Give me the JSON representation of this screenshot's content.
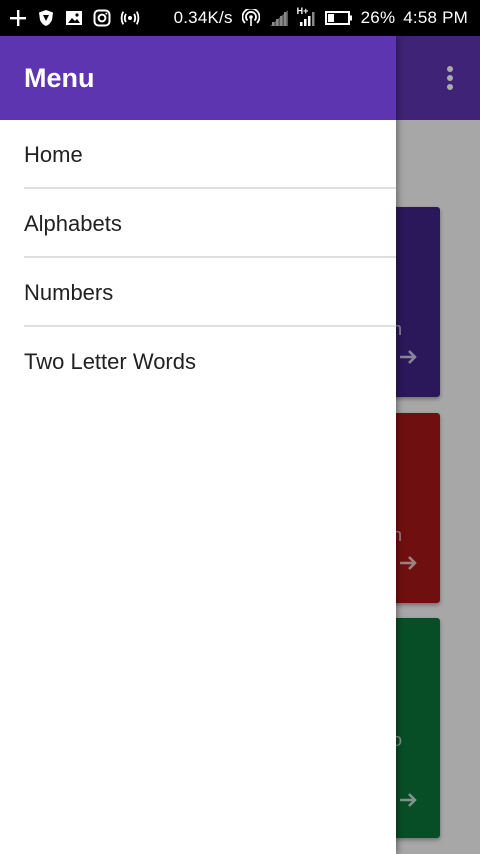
{
  "status_bar": {
    "net_speed": "0.34K/s",
    "network_type": "H+",
    "battery": "26%",
    "time": "4:58 PM",
    "icons": [
      "add-icon",
      "shield-icon",
      "image-icon",
      "instagram-icon",
      "broadcast-icon",
      "hotspot-icon",
      "signal-icon",
      "signal-h-plus-icon",
      "battery-icon"
    ]
  },
  "drawer": {
    "title": "Menu",
    "items": [
      {
        "label": "Home"
      },
      {
        "label": "Alphabets"
      },
      {
        "label": "Numbers"
      },
      {
        "label": "Two Letter Words"
      }
    ]
  },
  "background": {
    "overflow_icon": "more-vert-icon",
    "cards": [
      {
        "color": "#3f2587",
        "visible_text": "n"
      },
      {
        "color": "#a71717",
        "visible_text": "n"
      },
      {
        "color": "#0b753a",
        "visible_text": "io"
      }
    ]
  },
  "colors": {
    "primary": "#5e35b1",
    "status_bar": "#000000",
    "drawer_bg": "#ffffff",
    "divider": "#e0e0e0"
  }
}
